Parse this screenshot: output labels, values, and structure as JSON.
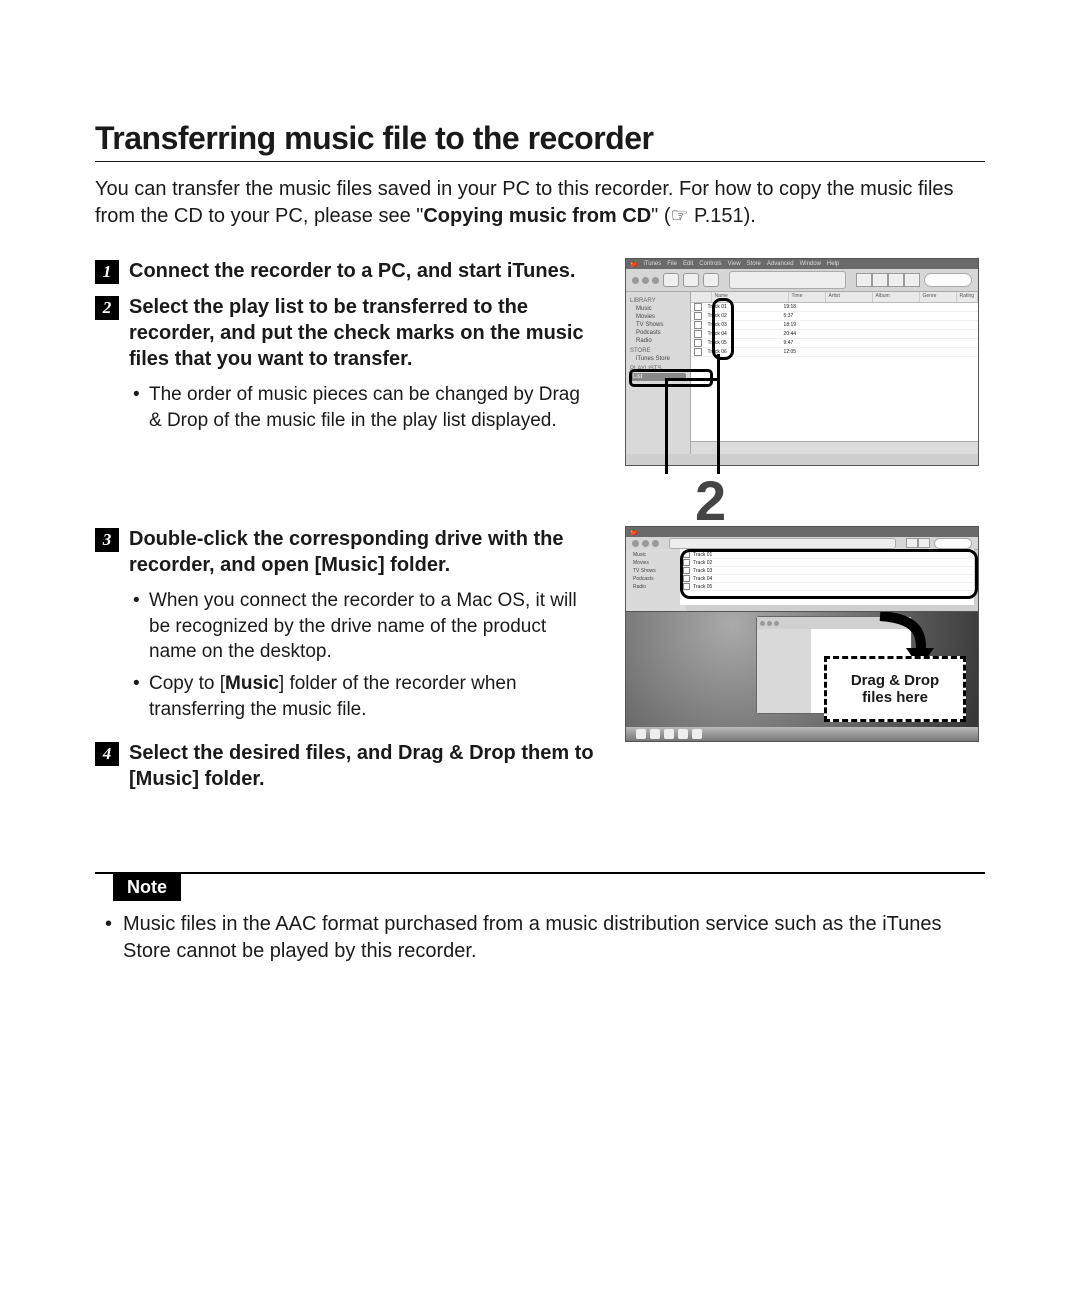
{
  "title": "Transferring music file to the recorder",
  "intro_a": "You can transfer the music files saved in your PC to this recorder. For how to copy the music files from the CD to your PC, please see \"",
  "intro_bold": "Copying music from CD",
  "intro_b": "\" (☞ P.151).",
  "steps": {
    "s1_num": "1",
    "s1": "Connect the recorder to a PC, and start iTunes.",
    "s2_num": "2",
    "s2": "Select the play list to be transferred to the recorder, and put the check marks on the music files that you want to transfer.",
    "s2_sub1": "The order of music pieces can be changed by Drag & Drop of the music file in the play list displayed.",
    "s3_num": "3",
    "s3_a": "Double-click the corresponding drive with the recorder, and open [",
    "s3_music": "Music",
    "s3_b": "] folder.",
    "s3_sub1": "When you connect the recorder to a Mac OS, it will be recognized by the drive name of the product name on the desktop.",
    "s3_sub2_a": "Copy to [",
    "s3_sub2_music": "Music",
    "s3_sub2_b": "] folder of the recorder when transferring the music file.",
    "s4_num": "4",
    "s4_a": "Select the desired files, and Drag & Drop them to [",
    "s4_music": "Music",
    "s4_b": "] folder."
  },
  "callout_num": "2",
  "dropbox_l1": "Drag & Drop",
  "dropbox_l2": "files here",
  "note_label": "Note",
  "note_1": "Music files in the AAC format purchased from a music distribution service such as the iTunes Store cannot be played by this recorder.",
  "itunes": {
    "menu": [
      "iTunes",
      "File",
      "Edit",
      "Controls",
      "View",
      "Store",
      "Advanced",
      "Window",
      "Help"
    ],
    "side_hdr1": "LIBRARY",
    "side_items1": [
      "Music",
      "Movies",
      "TV Shows",
      "Podcasts",
      "Radio"
    ],
    "side_hdr2": "STORE",
    "side_items2": [
      "iTunes Store"
    ],
    "side_hdr3": "PLAYLISTS",
    "side_sel": "List",
    "cols": [
      "Name",
      "Time",
      "Artist",
      "Album",
      "Genre",
      "Rating"
    ],
    "tracks": [
      {
        "name": "Track 01",
        "time": "19:18"
      },
      {
        "name": "Track 02",
        "time": "5:37"
      },
      {
        "name": "Track 03",
        "time": "18:19"
      },
      {
        "name": "Track 04",
        "time": "20:44"
      },
      {
        "name": "Track 05",
        "time": "9:47"
      },
      {
        "name": "Track 06",
        "time": "12:05"
      }
    ]
  }
}
